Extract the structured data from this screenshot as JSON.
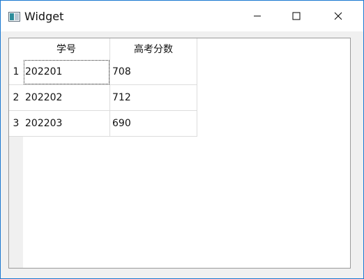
{
  "window": {
    "title": "Widget",
    "icon": "app-window-icon",
    "controls": {
      "minimize": "minimize-icon",
      "maximize": "maximize-icon",
      "close": "close-icon"
    }
  },
  "table": {
    "columns": [
      "学号",
      "高考分数"
    ],
    "rows": [
      {
        "header": "1",
        "cells": [
          "202201",
          "708"
        ]
      },
      {
        "header": "2",
        "cells": [
          "202202",
          "712"
        ]
      },
      {
        "header": "3",
        "cells": [
          "202203",
          "690"
        ]
      }
    ],
    "focused_cell": "row 1, column 1"
  }
}
